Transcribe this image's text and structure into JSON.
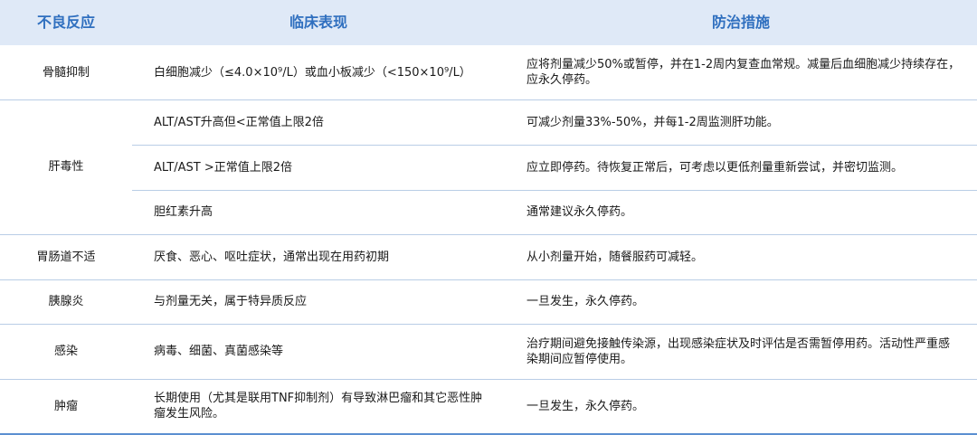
{
  "header": {
    "col1": "不良反应",
    "col2": "临床表现",
    "col3": "防治措施"
  },
  "rows": [
    {
      "category": "骨髓抑制",
      "items": [
        {
          "manifestation": "白细胞减少（≤4.0×10⁹/L）或血小板减少（<150×10⁹/L）",
          "measure": "应将剂量减少50%或暂停，并在1-2周内复查血常规。减量后血细胞减少持续存在，应永久停药。"
        }
      ]
    },
    {
      "category": "肝毒性",
      "items": [
        {
          "manifestation": "ALT/AST升高但<正常值上限2倍",
          "measure": "可减少剂量33%-50%，并每1-2周监测肝功能。"
        },
        {
          "manifestation": "ALT/AST >正常值上限2倍",
          "measure": "应立即停药。待恢复正常后，可考虑以更低剂量重新尝试，并密切监测。"
        },
        {
          "manifestation": "胆红素升高",
          "measure": "通常建议永久停药。"
        }
      ]
    },
    {
      "category": "胃肠道不适",
      "items": [
        {
          "manifestation": "厌食、恶心、呕吐症状，通常出现在用药初期",
          "measure": "从小剂量开始，随餐服药可减轻。"
        }
      ]
    },
    {
      "category": "胰腺炎",
      "items": [
        {
          "manifestation": "与剂量无关，属于特异质反应",
          "measure": "一旦发生，永久停药。"
        }
      ]
    },
    {
      "category": "感染",
      "items": [
        {
          "manifestation": "病毒、细菌、真菌感染等",
          "measure": "治疗期间避免接触传染源，出现感染症状及时评估是否需暂停用药。活动性严重感染期间应暂停使用。"
        }
      ]
    },
    {
      "category": "肿瘤",
      "items": [
        {
          "manifestation": "长期使用（尤其是联用TNF抑制剂）有导致淋巴瘤和其它恶性肿瘤发生风险。",
          "measure": "一旦发生，永久停药。"
        }
      ]
    }
  ],
  "colors": {
    "header_bg": "#dfe9f7",
    "header_text": "#2f6fbf",
    "row_line": "#b9cde6",
    "bottom_line": "#5b8fd1"
  }
}
